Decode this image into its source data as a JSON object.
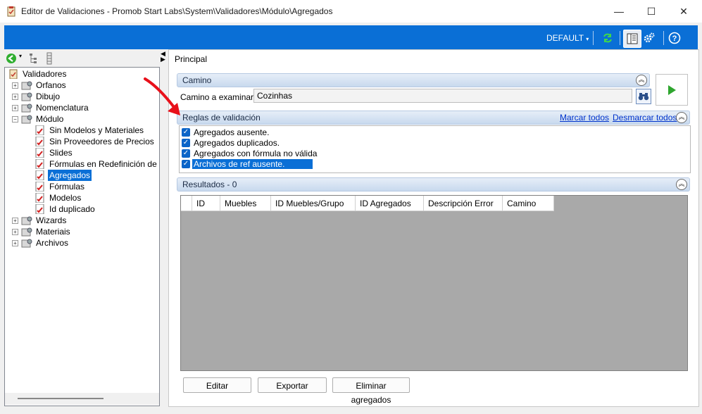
{
  "window": {
    "title": "Editor de Validaciones - Promob Start Labs\\System\\Validadores\\Módulo\\Agregados",
    "minimize": "—",
    "maximize": "☐",
    "close": "✕"
  },
  "toolbar": {
    "profile": "DEFAULT",
    "icons": [
      "refresh-icon",
      "panel-view-icon",
      "settings-icon",
      "help-icon"
    ]
  },
  "tree": {
    "root": "Validadores",
    "items": [
      {
        "label": "Orfanos"
      },
      {
        "label": "Dibujo"
      },
      {
        "label": "Nomenclatura"
      },
      {
        "label": "Módulo"
      },
      {
        "label": "Sin Modelos y Materiales"
      },
      {
        "label": "Sin Proveedores de Precios"
      },
      {
        "label": "Slides"
      },
      {
        "label": "Fórmulas en Redefinición de la"
      },
      {
        "label": "Agregados"
      },
      {
        "label": "Fórmulas"
      },
      {
        "label": "Modelos"
      },
      {
        "label": "Id duplicado"
      },
      {
        "label": "Wizards"
      },
      {
        "label": "Materiais"
      },
      {
        "label": "Archivos"
      }
    ],
    "selected": "Agregados"
  },
  "main": {
    "tab": "Principal",
    "camino": {
      "header": "Camino",
      "label": "Camino a examinar",
      "value": "Cozinhas"
    },
    "rules": {
      "header": "Reglas de validación",
      "select_all": "Marcar todos",
      "deselect_all": "Desmarcar todos",
      "items": [
        {
          "label": "Agregados ausente.",
          "checked": true
        },
        {
          "label": "Agregados duplicados.",
          "checked": true
        },
        {
          "label": "Agregados con fórmula no válida",
          "checked": true
        },
        {
          "label": "Archivos de ref ausente.",
          "checked": true
        }
      ]
    },
    "results": {
      "header": "Resultados - 0",
      "columns": [
        "ID",
        "Muebles",
        "ID Muebles/Grupo",
        "ID Agregados",
        "Descripción Error",
        "Camino"
      ]
    },
    "buttons": {
      "edit": "Editar",
      "export": "Exportar",
      "delete_aggregates": "Eliminar agregados"
    }
  },
  "colors": {
    "toolbar_blue": "#0a6fd6",
    "selection_blue": "#0a6fd6",
    "grid_gray": "#a9a9a9",
    "annotation_red": "#e8101a"
  }
}
